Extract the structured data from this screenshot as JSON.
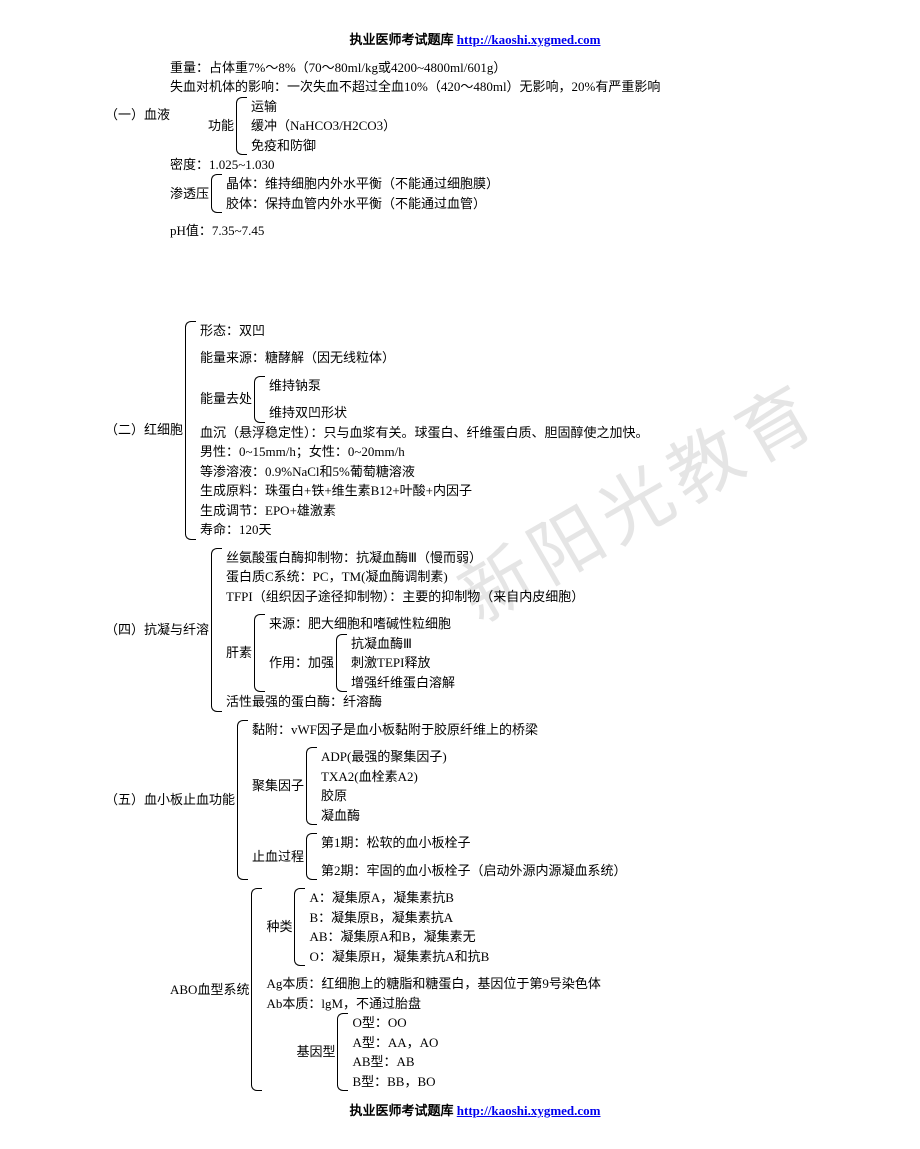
{
  "header": {
    "title": "执业医师考试题库 ",
    "url": "http://kaoshi.xygmed.com"
  },
  "footer": {
    "title": "执业医师考试题库 ",
    "url": "http://kaoshi.xygmed.com"
  },
  "watermark": "新阳光教育",
  "s1": {
    "label": "（一）血液",
    "weight": "重量：占体重7%～8%（70～80ml/kg或4200~4800ml/601g）",
    "bloodloss": "失血对机体的影响：一次失血不超过全血10%（420～480ml）无影响，20%有严重影响",
    "func_label": "功能",
    "f1": "运输",
    "f2": "缓冲（NaHCO3/H2CO3）",
    "f3": "免疫和防御",
    "density": "密度：1.025~1.030",
    "osm_label": "渗透压",
    "osm1": "晶体：维持细胞内外水平衡（不能通过细胞膜）",
    "osm2": "胶体：保持血管内外水平衡（不能通过血管）",
    "ph": "pH值：7.35~7.45"
  },
  "s2": {
    "label": "（二）红细胞",
    "l1": "形态：双凹",
    "l2": "能量来源：糖酵解（因无线粒体）",
    "e_label": "能量去处",
    "e1": "维持钠泵",
    "e2": "维持双凹形状",
    "l3": "血沉（悬浮稳定性）：只与血浆有关。球蛋白、纤维蛋白质、胆固醇使之加快。",
    "l4": "  男性：0~15mm/h；女性：0~20mm/h",
    "l5": "等渗溶液：0.9%NaCl和5%葡萄糖溶液",
    "l6": "生成原料：珠蛋白+铁+维生素B12+叶酸+内因子",
    "l7": "生成调节：EPO+雄激素",
    "l8": "寿命：120天"
  },
  "s4": {
    "label": "（四）抗凝与纤溶",
    "l1": "丝氨酸蛋白酶抑制物：抗凝血酶Ⅲ（慢而弱）",
    "l2": "蛋白质C系统：PC，TM(凝血酶调制素)",
    "l3": "TFPI（组织因子途径抑制物）：主要的抑制物（来自内皮细胞）",
    "hep_label": "肝素",
    "hep1": "来源：肥大细胞和嗜碱性粒细胞",
    "hep2_label": "作用：加强",
    "hep2a": "抗凝血酶Ⅲ",
    "hep2b": "刺激TEPI释放",
    "hep2c": "增强纤维蛋白溶解",
    "l4": "活性最强的蛋白酶：纤溶酶"
  },
  "s5": {
    "label": "（五）血小板止血功能",
    "l1": "黏附：vWF因子是血小板黏附于胶原纤维上的桥梁",
    "agg_label": "聚集因子",
    "a1": "ADP(最强的聚集因子)",
    "a2": "TXA2(血栓素A2)",
    "a3": "胶原",
    "a4": "凝血酶",
    "stop_label": "止血过程",
    "s_a": "第1期：松软的血小板栓子",
    "s_b": "第2期：牢固的血小板栓子（启动外源内源凝血系统）"
  },
  "s6": {
    "abo_label": "ABO血型系统",
    "type_label": "种类",
    "t1": "A：凝集原A，凝集素抗B",
    "t2": "B：凝集原B，凝集素抗A",
    "t3": "AB：凝集原A和B，凝集素无",
    "t4": "O：凝集原H，凝集素抗A和抗B",
    "ag": "Ag本质：红细胞上的糖脂和糖蛋白，基因位于第9号染色体",
    "ab": "Ab本质：lgM，不通过胎盘",
    "gene_label": "基因型",
    "g1": "O型：OO",
    "g2": "A型：AA，AO",
    "g3": "AB型：AB",
    "g4": "B型：BB，BO"
  }
}
